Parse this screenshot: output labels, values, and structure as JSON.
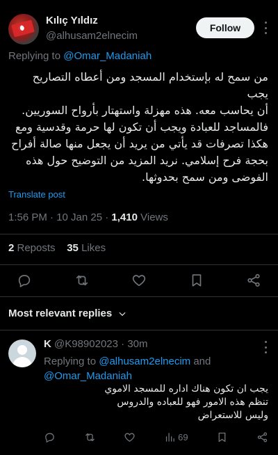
{
  "tweet": {
    "author_name": "Kılıç Yıldız",
    "author_handle": "@alhusam2elnecim",
    "follow_label": "Follow",
    "replying_prefix": "Replying to ",
    "replying_to": "@Omar_Madaniah",
    "body_lines": [
      "من سمح له بإستخدام المسجد ومن أعطاه التصاريح يجب",
      "أن يحاسب معه. هذه مهزلة واستهتار بأرواح السوريين.",
      "فالمساجد للعبادة ويجب أن تكون لها حرمة وقدسية ومع",
      "هكذا تصرفات قد يأتي من يريد أن يجعل منها صالة أفراح",
      "بحجة فرح إسلامي. نريد المزيد من التوضيح حول هذه",
      "الفوضى ومن سمح بحدوثها."
    ],
    "translate_label": "Translate post",
    "time": "1:56 PM · 10 Jan 25 · ",
    "views_count": "1,410",
    "views_label": " Views",
    "reposts_count": "2",
    "reposts_label": " Reposts",
    "likes_count": "35",
    "likes_label": " Likes"
  },
  "replies_section": {
    "title": "Most relevant replies"
  },
  "reply": {
    "author_name": "K",
    "author_handle": "@K98902023",
    "time": " · 30m",
    "replying_prefix": "Replying to ",
    "replying_to_1": "@alhusam2elnecim",
    "replying_and": " and ",
    "replying_to_2": "@Omar_Madaniah",
    "body_lines": [
      "يجب ان تكون هناك اداره للمسجد الاموي",
      "تنظم هذه الامور فهو للعباده والدروس",
      "وليس للاستعراض"
    ],
    "views_count": "69"
  },
  "icons": {
    "reply": "reply-icon",
    "repost": "repost-icon",
    "like": "heart-icon",
    "bookmark": "bookmark-icon",
    "share": "share-icon",
    "views": "views-icon",
    "chevron": "chevron-down-icon"
  },
  "colors": {
    "background": "#000000",
    "text": "#e7e9ea",
    "muted": "#71767b",
    "accent": "#1d9bf0",
    "divider": "#2f3336"
  }
}
